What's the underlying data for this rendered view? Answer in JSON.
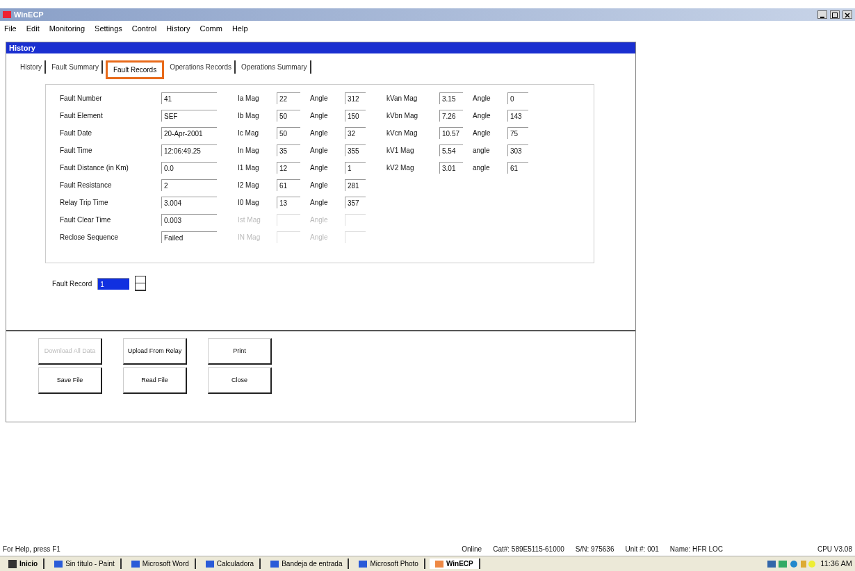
{
  "window": {
    "title": "WinECP"
  },
  "menu": [
    "File",
    "Edit",
    "Monitoring",
    "Settings",
    "Control",
    "History",
    "Comm",
    "Help"
  ],
  "child": {
    "title": "History"
  },
  "tabs": [
    {
      "label": "History",
      "selected": false
    },
    {
      "label": "Fault Summary",
      "selected": false
    },
    {
      "label": "Fault Records",
      "selected": true
    },
    {
      "label": "Operations Records",
      "selected": false
    },
    {
      "label": "Operations Summary",
      "selected": false
    }
  ],
  "fault_fields": [
    {
      "label": "Fault Number",
      "value": "41"
    },
    {
      "label": "Fault Element",
      "value": "SEF"
    },
    {
      "label": "Fault Date",
      "value": "20-Apr-2001"
    },
    {
      "label": "Fault Time",
      "value": "12:06:49.25"
    },
    {
      "label": "Fault Distance (in Km)",
      "value": "0.0"
    },
    {
      "label": "Fault Resistance",
      "value": "2"
    },
    {
      "label": "Relay Trip Time",
      "value": "3.004"
    },
    {
      "label": "Fault Clear Time",
      "value": "0.003"
    },
    {
      "label": "Reclose Sequence",
      "value": "Failed"
    }
  ],
  "currents": [
    {
      "label": "Ia Mag",
      "value": "22",
      "angle_label": "Angle",
      "angle": "312",
      "disabled": false
    },
    {
      "label": "Ib Mag",
      "value": "50",
      "angle_label": "Angle",
      "angle": "150",
      "disabled": false
    },
    {
      "label": "Ic Mag",
      "value": "50",
      "angle_label": "Angle",
      "angle": "32",
      "disabled": false
    },
    {
      "label": "In Mag",
      "value": "35",
      "angle_label": "Angle",
      "angle": "355",
      "disabled": false
    },
    {
      "label": "I1 Mag",
      "value": "12",
      "angle_label": "Angle",
      "angle": "1",
      "disabled": false
    },
    {
      "label": "I2 Mag",
      "value": "61",
      "angle_label": "Angle",
      "angle": "281",
      "disabled": false
    },
    {
      "label": "I0 Mag",
      "value": "13",
      "angle_label": "Angle",
      "angle": "357",
      "disabled": false
    },
    {
      "label": "Ist Mag",
      "angle_label": "Angle",
      "disabled": true
    },
    {
      "label": "IN Mag",
      "angle_label": "Angle",
      "disabled": true
    }
  ],
  "voltages": [
    {
      "label": "kVan Mag",
      "value": "3.15",
      "angle_label": "Angle",
      "angle": "0"
    },
    {
      "label": "kVbn Mag",
      "value": "7.26",
      "angle_label": "Angle",
      "angle": "143"
    },
    {
      "label": "kVcn Mag",
      "value": "10.57",
      "angle_label": "Angle",
      "angle": "75"
    },
    {
      "label": "kV1 Mag",
      "value": "5.54",
      "angle_label": "angle",
      "angle": "303"
    },
    {
      "label": "kV2 Mag",
      "value": "3.01",
      "angle_label": "angle",
      "angle": "61"
    }
  ],
  "fault_record": {
    "label": "Fault Record",
    "value": "1",
    "selected": true
  },
  "buttons": [
    {
      "label": "Download All Data",
      "disabled": true
    },
    {
      "label": "Upload From Relay",
      "disabled": false
    },
    {
      "label": "Print",
      "disabled": false
    },
    {
      "label": "Save File",
      "disabled": false
    },
    {
      "label": "Read File",
      "disabled": false
    },
    {
      "label": "Close",
      "disabled": false
    }
  ],
  "status_bar": {
    "help": "For Help, press F1",
    "panes": [
      "Online",
      "Cat#: 589E5115-61000",
      "S/N: 975636",
      "Unit #: 001",
      "Name: HFR LOC"
    ],
    "version": "CPU V3.08"
  },
  "taskbar": {
    "start": "Inicio",
    "items": [
      {
        "label": "Sin título - Paint",
        "active": false
      },
      {
        "label": "Microsoft Word",
        "active": false
      },
      {
        "label": "Calculadora",
        "active": false
      },
      {
        "label": "Bandeja de entrada",
        "active": false
      },
      {
        "label": "Microsoft Photo",
        "active": false
      },
      {
        "label": "WinECP",
        "active": true
      }
    ],
    "clock": "11:36 AM"
  }
}
